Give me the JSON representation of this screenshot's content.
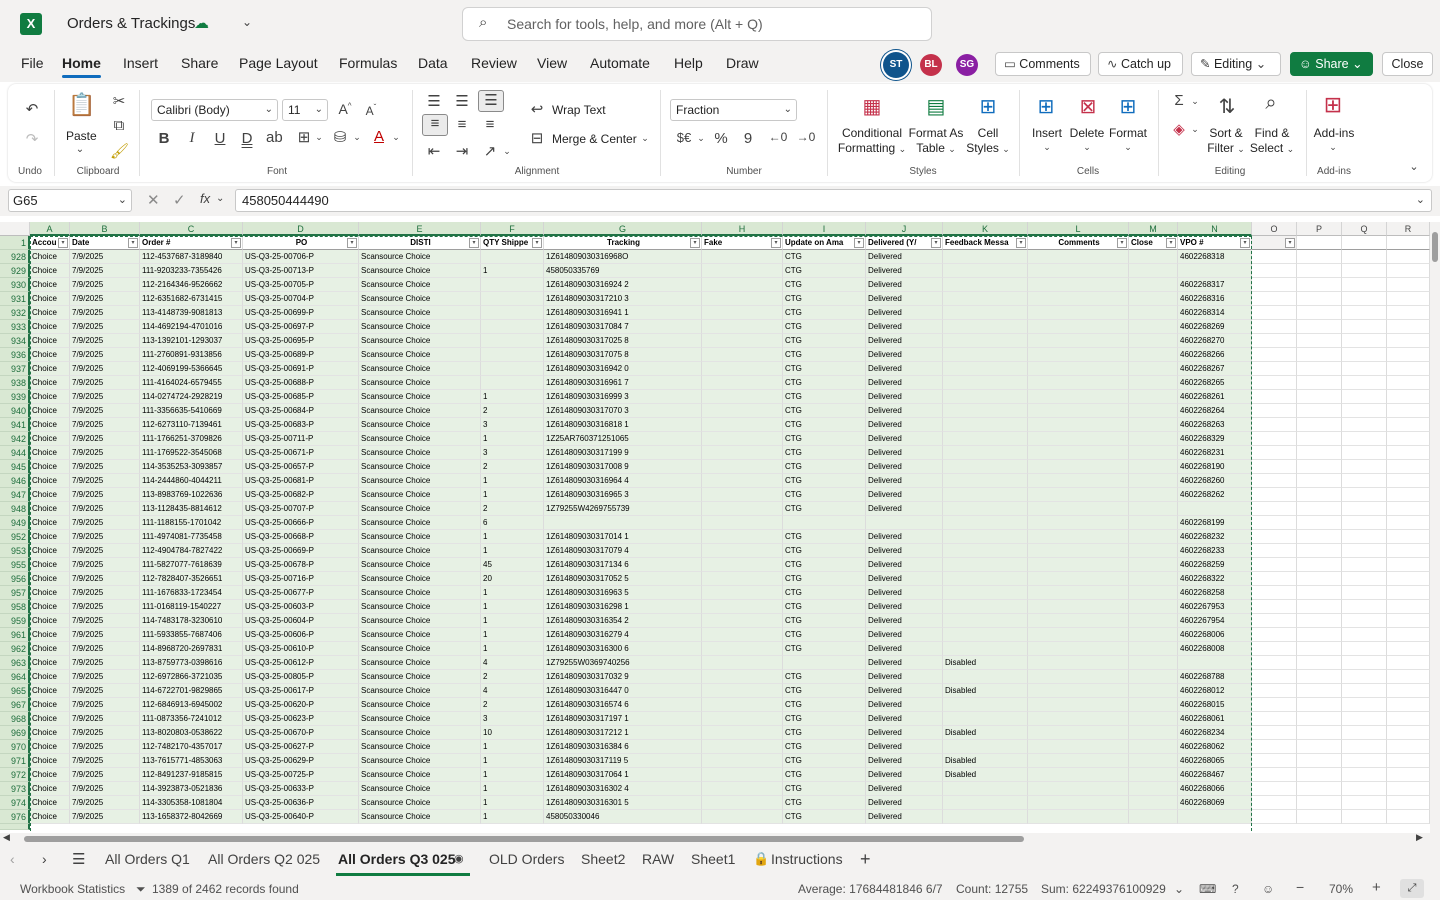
{
  "title": {
    "app_letter": "X",
    "document_name": "Orders & Trackings",
    "search_placeholder": "Search for tools, help, and more (Alt + Q)"
  },
  "menu": {
    "items": [
      "File",
      "Home",
      "Insert",
      "Share",
      "Page Layout",
      "Formulas",
      "Data",
      "Review",
      "View",
      "Automate",
      "Help",
      "Draw"
    ],
    "active": "Home",
    "avatars": [
      {
        "initials": "ST",
        "color": "#0f548c"
      },
      {
        "initials": "BL",
        "color": "#c4314b"
      },
      {
        "initials": "SG",
        "color": "#8a1fa3"
      }
    ],
    "comments": "Comments",
    "catch_up": "Catch up",
    "editing": "Editing",
    "share": "Share",
    "close": "Close"
  },
  "ribbon": {
    "undo_group": "Undo",
    "clipboard_group": "Clipboard",
    "paste": "Paste",
    "font_group": "Font",
    "font_name": "Calibri (Body)",
    "font_size": "11",
    "alignment_group": "Alignment",
    "wrap_text": "Wrap Text",
    "merge_center": "Merge & Center",
    "number_group": "Number",
    "number_format": "Fraction",
    "styles_group": "Styles",
    "conditional_formatting": [
      "Conditional",
      "Formatting"
    ],
    "format_as_table": [
      "Format As",
      "Table"
    ],
    "cell_styles": [
      "Cell",
      "Styles"
    ],
    "cells_group": "Cells",
    "insert": "Insert",
    "delete": "Delete",
    "format": "Format",
    "editing_group": "Editing",
    "sort_filter": [
      "Sort &",
      "Filter"
    ],
    "find_select": [
      "Find &",
      "Select"
    ],
    "addins_group": "Add-ins",
    "addins": "Add-ins"
  },
  "formula": {
    "name_box": "G65",
    "formula": "458050444490"
  },
  "columns": [
    "A",
    "B",
    "C",
    "D",
    "E",
    "F",
    "G",
    "H",
    "I",
    "J",
    "K",
    "L",
    "M",
    "N",
    "O",
    "P",
    "Q",
    "R"
  ],
  "headers": [
    "Accou",
    "Date",
    "Order #",
    "PO",
    "DISTI",
    "QTY Shippe",
    "Tracking",
    "Fake",
    "Update on Ama",
    "Delivered (Y/",
    "Feedback Messa",
    "Comments",
    "Close",
    "VPO #"
  ],
  "rows": [
    [
      "928",
      "Choice",
      "7/9/2025",
      "112-4537687-3189840",
      "US-Q3-25-00706-P",
      "Scansource Choice",
      "",
      "1Z614809030316968O",
      "",
      "CTG",
      "Delivered",
      "",
      "",
      "",
      "4602268318"
    ],
    [
      "929",
      "Choice",
      "7/9/2025",
      "111-9203233-7355426",
      "US-Q3-25-00713-P",
      "Scansource Choice",
      "1",
      "458050335769",
      "",
      "CTG",
      "Delivered",
      "",
      "",
      "",
      ""
    ],
    [
      "930",
      "Choice",
      "7/9/2025",
      "112-2164346-9526662",
      "US-Q3-25-00705-P",
      "Scansource Choice",
      "",
      "1Z614809030316924 2",
      "",
      "CTG",
      "Delivered",
      "",
      "",
      "",
      "4602268317"
    ],
    [
      "931",
      "Choice",
      "7/9/2025",
      "112-6351682-6731415",
      "US-Q3-25-00704-P",
      "Scansource Choice",
      "",
      "1Z614809030317210 3",
      "",
      "CTG",
      "Delivered",
      "",
      "",
      "",
      "4602268316"
    ],
    [
      "932",
      "Choice",
      "7/9/2025",
      "113-4148739-9081813",
      "US-Q3-25-00699-P",
      "Scansource Choice",
      "",
      "1Z614809030316941 1",
      "",
      "CTG",
      "Delivered",
      "",
      "",
      "",
      "4602268314"
    ],
    [
      "933",
      "Choice",
      "7/9/2025",
      "114-4692194-4701016",
      "US-Q3-25-00697-P",
      "Scansource Choice",
      "",
      "1Z614809030317084 7",
      "",
      "CTG",
      "Delivered",
      "",
      "",
      "",
      "4602268269"
    ],
    [
      "934",
      "Choice",
      "7/9/2025",
      "113-1392101-1293037",
      "US-Q3-25-00695-P",
      "Scansource Choice",
      "",
      "1Z614809030317025 8",
      "",
      "CTG",
      "Delivered",
      "",
      "",
      "",
      "4602268270"
    ],
    [
      "936",
      "Choice",
      "7/9/2025",
      "111-2760891-9313856",
      "US-Q3-25-00689-P",
      "Scansource Choice",
      "",
      "1Z614809030317075 8",
      "",
      "CTG",
      "Delivered",
      "",
      "",
      "",
      "4602268266"
    ],
    [
      "937",
      "Choice",
      "7/9/2025",
      "112-4069199-5366645",
      "US-Q3-25-00691-P",
      "Scansource Choice",
      "",
      "1Z614809030316942 0",
      "",
      "CTG",
      "Delivered",
      "",
      "",
      "",
      "4602268267"
    ],
    [
      "938",
      "Choice",
      "7/9/2025",
      "111-4164024-6579455",
      "US-Q3-25-00688-P",
      "Scansource Choice",
      "",
      "1Z614809030316961 7",
      "",
      "CTG",
      "Delivered",
      "",
      "",
      "",
      "4602268265"
    ],
    [
      "939",
      "Choice",
      "7/9/2025",
      "114-0274724-2928219",
      "US-Q3-25-00685-P",
      "Scansource Choice",
      "1",
      "1Z614809030316999 3",
      "",
      "CTG",
      "Delivered",
      "",
      "",
      "",
      "4602268261"
    ],
    [
      "940",
      "Choice",
      "7/9/2025",
      "111-3356635-5410669",
      "US-Q3-25-00684-P",
      "Scansource Choice",
      "2",
      "1Z614809030317070 3",
      "",
      "CTG",
      "Delivered",
      "",
      "",
      "",
      "4602268264"
    ],
    [
      "941",
      "Choice",
      "7/9/2025",
      "112-6273110-7139461",
      "US-Q3-25-00683-P",
      "Scansource Choice",
      "3",
      "1Z614809030316818 1",
      "",
      "CTG",
      "Delivered",
      "",
      "",
      "",
      "4602268263"
    ],
    [
      "942",
      "Choice",
      "7/9/2025",
      "111-1766251-3709826",
      "US-Q3-25-00711-P",
      "Scansource Choice",
      "1",
      "1Z25AR760371251065",
      "",
      "CTG",
      "Delivered",
      "",
      "",
      "",
      "4602268329"
    ],
    [
      "944",
      "Choice",
      "7/9/2025",
      "111-1769522-3545068",
      "US-Q3-25-00671-P",
      "Scansource Choice",
      "3",
      "1Z614809030317199 9",
      "",
      "CTG",
      "Delivered",
      "",
      "",
      "",
      "4602268231"
    ],
    [
      "945",
      "Choice",
      "7/9/2025",
      "114-3535253-3093857",
      "US-Q3-25-00657-P",
      "Scansource Choice",
      "2",
      "1Z614809030317008 9",
      "",
      "CTG",
      "Delivered",
      "",
      "",
      "",
      "4602268190"
    ],
    [
      "946",
      "Choice",
      "7/9/2025",
      "114-2444860-4044211",
      "US-Q3-25-00681-P",
      "Scansource Choice",
      "1",
      "1Z614809030316964 4",
      "",
      "CTG",
      "Delivered",
      "",
      "",
      "",
      "4602268260"
    ],
    [
      "947",
      "Choice",
      "7/9/2025",
      "113-8983769-1022636",
      "US-Q3-25-00682-P",
      "Scansource Choice",
      "1",
      "1Z614809030316965 3",
      "",
      "CTG",
      "Delivered",
      "",
      "",
      "",
      "4602268262"
    ],
    [
      "948",
      "Choice",
      "7/9/2025",
      "113-1128435-8814612",
      "US-Q3-25-00707-P",
      "Scansource Choice",
      "2",
      "1Z79255W4269755739",
      "",
      "CTG",
      "Delivered",
      "",
      "",
      "",
      ""
    ],
    [
      "949",
      "Choice",
      "7/9/2025",
      "111-1188155-1701042",
      "US-Q3-25-00666-P",
      "Scansource Choice",
      "6",
      "",
      "",
      "",
      "",
      "",
      "",
      "",
      "4602268199"
    ],
    [
      "952",
      "Choice",
      "7/9/2025",
      "111-4974081-7735458",
      "US-Q3-25-00668-P",
      "Scansource Choice",
      "1",
      "1Z614809030317014 1",
      "",
      "CTG",
      "Delivered",
      "",
      "",
      "",
      "4602268232"
    ],
    [
      "953",
      "Choice",
      "7/9/2025",
      "112-4904784-7827422",
      "US-Q3-25-00669-P",
      "Scansource Choice",
      "1",
      "1Z614809030317079 4",
      "",
      "CTG",
      "Delivered",
      "",
      "",
      "",
      "4602268233"
    ],
    [
      "955",
      "Choice",
      "7/9/2025",
      "111-5827077-7618639",
      "US-Q3-25-00678-P",
      "Scansource Choice",
      "45",
      "1Z614809030317134 6",
      "",
      "CTG",
      "Delivered",
      "",
      "",
      "",
      "4602268259"
    ],
    [
      "956",
      "Choice",
      "7/9/2025",
      "112-7828407-3526651",
      "US-Q3-25-00716-P",
      "Scansource Choice",
      "20",
      "1Z614809030317052 5",
      "",
      "CTG",
      "Delivered",
      "",
      "",
      "",
      "4602268322"
    ],
    [
      "957",
      "Choice",
      "7/9/2025",
      "111-1676833-1723454",
      "US-Q3-25-00677-P",
      "Scansource Choice",
      "1",
      "1Z614809030316963 5",
      "",
      "CTG",
      "Delivered",
      "",
      "",
      "",
      "4602268258"
    ],
    [
      "958",
      "Choice",
      "7/9/2025",
      "111-0168119-1540227",
      "US-Q3-25-00603-P",
      "Scansource Choice",
      "1",
      "1Z614809030316298 1",
      "",
      "CTG",
      "Delivered",
      "",
      "",
      "",
      "4602267953"
    ],
    [
      "959",
      "Choice",
      "7/9/2025",
      "114-7483178-3230610",
      "US-Q3-25-00604-P",
      "Scansource Choice",
      "1",
      "1Z614809030316354 2",
      "",
      "CTG",
      "Delivered",
      "",
      "",
      "",
      "4602267954"
    ],
    [
      "961",
      "Choice",
      "7/9/2025",
      "111-5933855-7687406",
      "US-Q3-25-00606-P",
      "Scansource Choice",
      "1",
      "1Z614809030316279 4",
      "",
      "CTG",
      "Delivered",
      "",
      "",
      "",
      "4602268006"
    ],
    [
      "962",
      "Choice",
      "7/9/2025",
      "114-8968720-2697831",
      "US-Q3-25-00610-P",
      "Scansource Choice",
      "1",
      "1Z614809030316300 6",
      "",
      "CTG",
      "Delivered",
      "",
      "",
      "",
      "4602268008"
    ],
    [
      "963",
      "Choice",
      "7/9/2025",
      "113-8759773-0398616",
      "US-Q3-25-00612-P",
      "Scansource Choice",
      "4",
      "1Z79255W0369740256",
      "",
      "",
      "Delivered",
      "Disabled",
      "",
      "",
      ""
    ],
    [
      "964",
      "Choice",
      "7/9/2025",
      "112-6972866-3721035",
      "US-Q3-25-00805-P",
      "Scansource Choice",
      "2",
      "1Z614809030317032 9",
      "",
      "CTG",
      "Delivered",
      "",
      "",
      "",
      "4602268788"
    ],
    [
      "965",
      "Choice",
      "7/9/2025",
      "114-6722701-9829865",
      "US-Q3-25-00617-P",
      "Scansource Choice",
      "4",
      "1Z614809030316447 0",
      "",
      "CTG",
      "Delivered",
      "Disabled",
      "",
      "",
      "4602268012"
    ],
    [
      "967",
      "Choice",
      "7/9/2025",
      "112-6846913-6945002",
      "US-Q3-25-00620-P",
      "Scansource Choice",
      "2",
      "1Z614809030316574 6",
      "",
      "CTG",
      "Delivered",
      "",
      "",
      "",
      "4602268015"
    ],
    [
      "968",
      "Choice",
      "7/9/2025",
      "111-0873356-7241012",
      "US-Q3-25-00623-P",
      "Scansource Choice",
      "3",
      "1Z614809030317197 1",
      "",
      "CTG",
      "Delivered",
      "",
      "",
      "",
      "4602268061"
    ],
    [
      "969",
      "Choice",
      "7/9/2025",
      "113-8020803-0538622",
      "US-Q3-25-00670-P",
      "Scansource Choice",
      "10",
      "1Z614809030317212 1",
      "",
      "CTG",
      "Delivered",
      "Disabled",
      "",
      "",
      "4602268234"
    ],
    [
      "970",
      "Choice",
      "7/9/2025",
      "112-7482170-4357017",
      "US-Q3-25-00627-P",
      "Scansource Choice",
      "1",
      "1Z614809030316384 6",
      "",
      "CTG",
      "Delivered",
      "",
      "",
      "",
      "4602268062"
    ],
    [
      "971",
      "Choice",
      "7/9/2025",
      "113-7615771-4853063",
      "US-Q3-25-00629-P",
      "Scansource Choice",
      "1",
      "1Z614809030317119 5",
      "",
      "CTG",
      "Delivered",
      "Disabled",
      "",
      "",
      "4602268065"
    ],
    [
      "972",
      "Choice",
      "7/9/2025",
      "112-8491237-9185815",
      "US-Q3-25-00725-P",
      "Scansource Choice",
      "1",
      "1Z614809030317064 1",
      "",
      "CTG",
      "Delivered",
      "Disabled",
      "",
      "",
      "4602268467"
    ],
    [
      "973",
      "Choice",
      "7/9/2025",
      "114-3923873-0521836",
      "US-Q3-25-00633-P",
      "Scansource Choice",
      "1",
      "1Z614809030316302 4",
      "",
      "CTG",
      "Delivered",
      "",
      "",
      "",
      "4602268066"
    ],
    [
      "974",
      "Choice",
      "7/9/2025",
      "114-3305358-1081804",
      "US-Q3-25-00636-P",
      "Scansource Choice",
      "1",
      "1Z614809030316301 5",
      "",
      "CTG",
      "Delivered",
      "",
      "",
      "",
      "4602268069"
    ],
    [
      "976",
      "Choice",
      "7/9/2025",
      "113-1658372-8042669",
      "US-Q3-25-00640-P",
      "Scansource Choice",
      "1",
      "458050330046",
      "",
      "CTG",
      "Delivered",
      "",
      "",
      "",
      ""
    ]
  ],
  "sheets": [
    "All Orders Q1",
    "All Orders Q2 025",
    "All Orders Q3 025",
    "OLD Orders",
    "Sheet2",
    "RAW",
    "Sheet1",
    "Instructions"
  ],
  "active_sheet": "All Orders Q3 025",
  "status": {
    "workbook_statistics": "Workbook Statistics",
    "records": "1389 of 2462 records found",
    "average": "Average: 17684481846 6/7",
    "count": "Count: 12755",
    "sum": "Sum: 62249376100929",
    "zoom": "70%"
  },
  "colors": {
    "excel_green": "#107c41",
    "accent": "#0f6cbd",
    "selection": "#217346"
  }
}
